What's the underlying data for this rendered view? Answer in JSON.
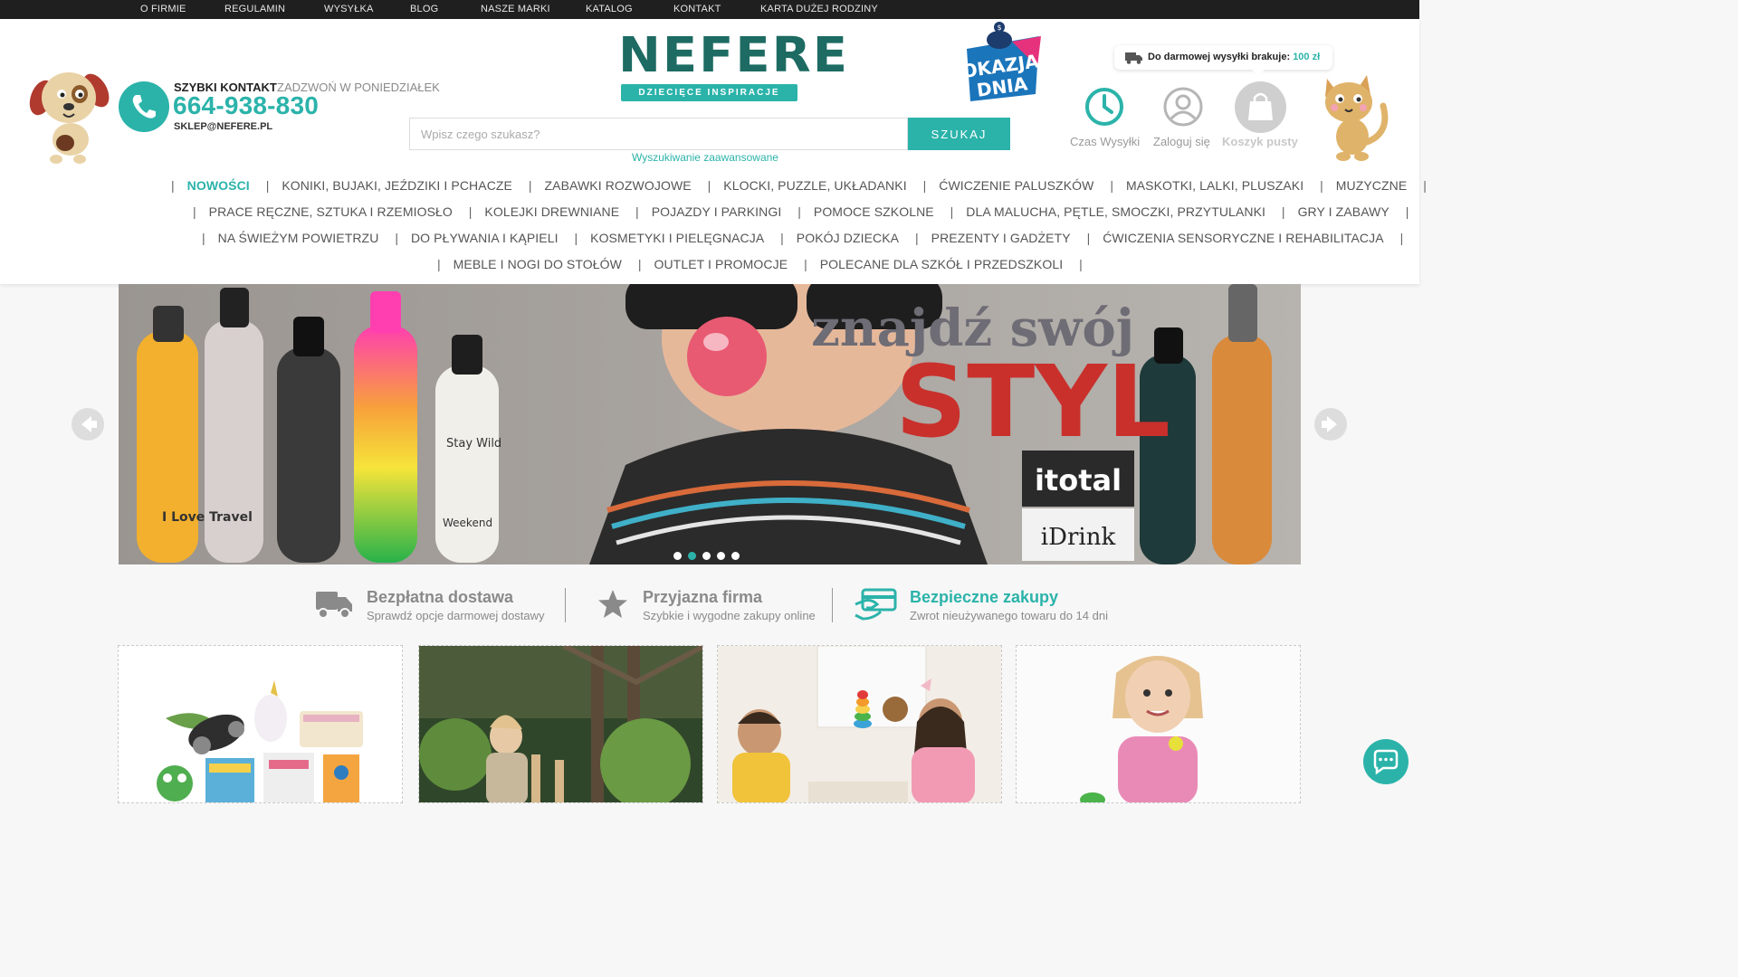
{
  "topbar": {
    "links": [
      "O FIRMIE",
      "REGULAMIN",
      "WYSYŁKA",
      "BLOG",
      "NASZE MARKI",
      "KATALOG",
      "KONTAKT",
      "KARTA DUŻEJ RODZINY"
    ]
  },
  "contact": {
    "title": "SZYBKI KONTAKT",
    "subtitle": "ZADZWOŃ W PONIEDZIAŁEK",
    "phone": "664-938-830",
    "email": "SKLEP@NEFERE.PL"
  },
  "logo": {
    "name": "NEFERE",
    "tagline": "DZIECIĘCE INSPIRACJE"
  },
  "promo_badge": {
    "line1": "OKAZJA",
    "line2": "DNIA"
  },
  "search": {
    "placeholder": "Wpisz czego szukasz?",
    "button_label": "SZUKAJ",
    "advanced_label": "Wyszukiwanie zaawansowane"
  },
  "shipping_tooltip": {
    "text": "Do darmowej wysyłki brakuje:",
    "amount": "100 zł"
  },
  "header_actions": {
    "shipping_time": "Czas Wysyłki",
    "login": "Zaloguj się",
    "cart": "Koszyk pusty"
  },
  "categories": {
    "row1": [
      "NOWOŚCI",
      "KONIKI, BUJAKI, JEŹDZIKI I PCHACZE",
      "ZABAWKI ROZWOJOWE",
      "KLOCKI, PUZZLE, UKŁADANKI",
      "ĆWICZENIE PALUSZKÓW",
      "MASKOTKI, LALKI, PLUSZAKI",
      "MUZYCZNE"
    ],
    "row2": [
      "PRACE RĘCZNE, SZTUKA I RZEMIOSŁO",
      "KOLEJKI DREWNIANE",
      "POJAZDY I PARKINGI",
      "POMOCE SZKOLNE",
      "DLA MALUCHA, PĘTLE, SMOCZKI, PRZYTULANKI",
      "GRY I ZABAWY"
    ],
    "row3": [
      "NA ŚWIEŻYM POWIETRZU",
      "DO PŁYWANIA I KĄPIELI",
      "KOSMETYKI I PIELĘGNACJA",
      "POKÓJ DZIECKA",
      "PREZENTY I GADŻETY",
      "ĆWICZENIA SENSORYCZNE I REHABILITACJA"
    ],
    "row4": [
      "MEBLE I NOGI DO STOŁÓW",
      "OUTLET I PROMOCJE",
      "POLECANE DLA SZKÓŁ I PRZEDSZKOLI"
    ]
  },
  "banner": {
    "headline_top": "znajdź swój",
    "headline_main": "STYL",
    "brand1": "itotal",
    "brand2": "iDrink",
    "bottle_texts": [
      "I Love Travel",
      "Stay Wild",
      "Weekend"
    ],
    "active_slide": 2,
    "slide_count": 5
  },
  "features": [
    {
      "title": "Bezpłatna dostawa",
      "subtitle": "Sprawdź opcje darmowej dostawy"
    },
    {
      "title": "Przyjazna firma",
      "subtitle": "Szybkie i wygodne zakupy online"
    },
    {
      "title": "Bezpieczne zakupy",
      "subtitle": "Zwrot nieużywanego towaru do 14 dni"
    }
  ],
  "colors": {
    "accent": "#2bb3aa",
    "topbar": "#1f1f1f",
    "logo": "#1d6b62",
    "feature_active": "#2bb3aa"
  }
}
